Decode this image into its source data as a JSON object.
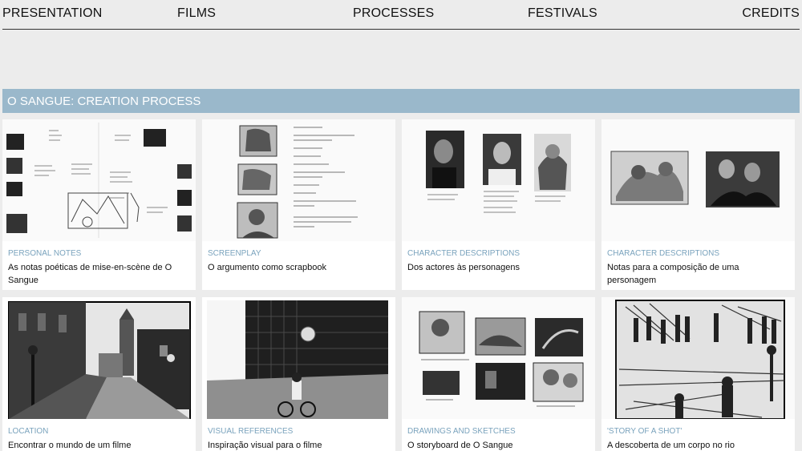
{
  "nav": {
    "items": [
      "PRESENTATION",
      "FILMS",
      "PROCESSES",
      "FESTIVALS",
      "CREDITS"
    ]
  },
  "section": {
    "title": "O SANGUE: CREATION PROCESS"
  },
  "cards": [
    {
      "category": "PERSONAL NOTES",
      "description": "As notas poéticas de mise-en-scène de O Sangue"
    },
    {
      "category": "SCREENPLAY",
      "description": "O argumento como scrapbook"
    },
    {
      "category": "CHARACTER DESCRIPTIONS",
      "description": "Dos actores às personagens"
    },
    {
      "category": "CHARACTER DESCRIPTIONS",
      "description": "Notas para a composição de uma personagem"
    },
    {
      "category": "LOCATION",
      "description": "Encontrar o mundo de um filme"
    },
    {
      "category": "VISUAL REFERENCES",
      "description": "Inspiração visual para o filme"
    },
    {
      "category": "DRAWINGS AND SKETCHES",
      "description": "O storyboard de O Sangue"
    },
    {
      "category": "'STORY OF A SHOT'",
      "description": "A descoberta de um corpo no rio"
    }
  ],
  "colors": {
    "section_bar": "#9ab8cb",
    "category_text": "#7aa3bd",
    "background": "#ececec"
  }
}
